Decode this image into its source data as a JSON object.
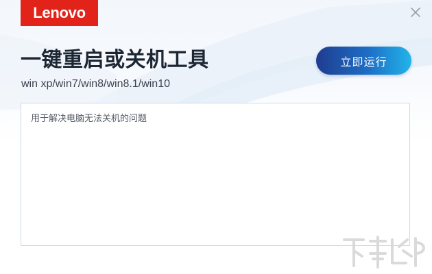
{
  "window": {
    "brand": "Lenovo",
    "title": "一键重启或关机工具",
    "subtitle": "win xp/win7/win8/win8.1/win10",
    "run_button_label": "立即运行",
    "description": "用于解决电脑无法关机的问题"
  },
  "icons": {
    "close": "close-icon",
    "watermark": "site-watermark-logo"
  },
  "colors": {
    "brand_red": "#e2231a",
    "button_gradient_start": "#1f3c8f",
    "button_gradient_end": "#22b4ea",
    "title_text": "#1c2733",
    "box_border": "#c9d9ec"
  }
}
